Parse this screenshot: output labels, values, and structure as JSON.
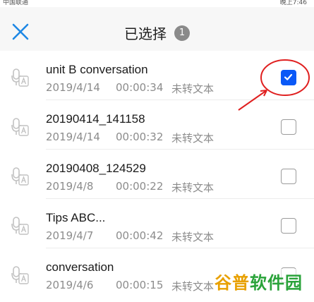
{
  "status_bar": {
    "carrier": "中国联通",
    "time": "晚上7:46"
  },
  "header": {
    "title": "已选择",
    "selected_count": "1",
    "close_icon": "close-icon"
  },
  "items": [
    {
      "name": "unit B conversation",
      "date": "2019/4/14",
      "duration": "00:00:34",
      "status": "未转文本",
      "checked": true
    },
    {
      "name": "20190414_141158",
      "date": "2019/4/14",
      "duration": "00:00:32",
      "status": "未转文本",
      "checked": false
    },
    {
      "name": "20190408_124529",
      "date": "2019/4/8",
      "duration": "00:00:22",
      "status": "未转文本",
      "checked": false
    },
    {
      "name": "Tips ABC...",
      "date": "2019/4/7",
      "duration": "00:00:42",
      "status": "未转文本",
      "checked": false
    },
    {
      "name": "conversation",
      "date": "2019/4/6",
      "duration": "00:00:15",
      "status": "未转文本",
      "checked": false
    }
  ],
  "watermark": {
    "text_part1": "谷普",
    "text_part2": "软件园"
  },
  "colors": {
    "accent": "#0a59f7",
    "annotation": "#e02020",
    "close": "#1e88e5"
  }
}
